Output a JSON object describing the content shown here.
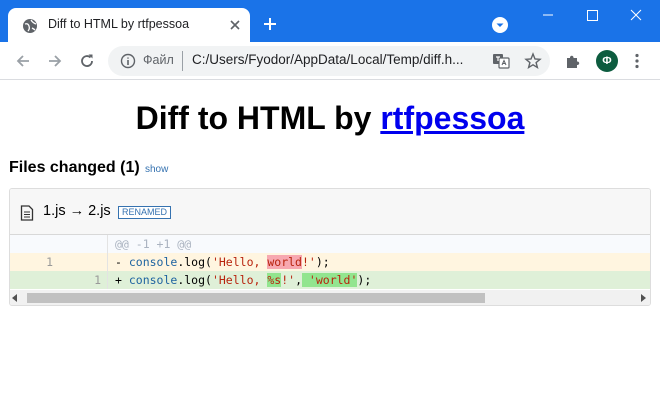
{
  "browser": {
    "tab_title": "Diff to HTML by rtfpessoa",
    "omnibox_label": "Файл",
    "url": "C:/Users/Fyodor/AppData/Local/Temp/diff.h...",
    "avatar_letter": "Ф",
    "accent_color": "#1a73e8"
  },
  "page": {
    "title_prefix": "Diff to HTML by ",
    "title_link": "rtfpessoa",
    "files_changed": "Files changed (1)",
    "show_link": "show"
  },
  "file": {
    "name": "1.js → 2.js",
    "tag": "RENAMED",
    "hunk_header": "@@ -1 +1 @@",
    "rows": {
      "del": {
        "old_line": "1",
        "prefix": "- ",
        "fn": "console",
        "mid1": ".log(",
        "str_open": "'Hello, ",
        "hl": "world",
        "str_close": "!'",
        "end": ");"
      },
      "ins": {
        "new_line": "1",
        "prefix": "+ ",
        "fn": "console",
        "mid1": ".log(",
        "str_open": "'Hello, ",
        "hl1": "%s",
        "str_close": "!'",
        "comma": ",",
        "hl2": " 'world'",
        "end": ");"
      }
    }
  }
}
